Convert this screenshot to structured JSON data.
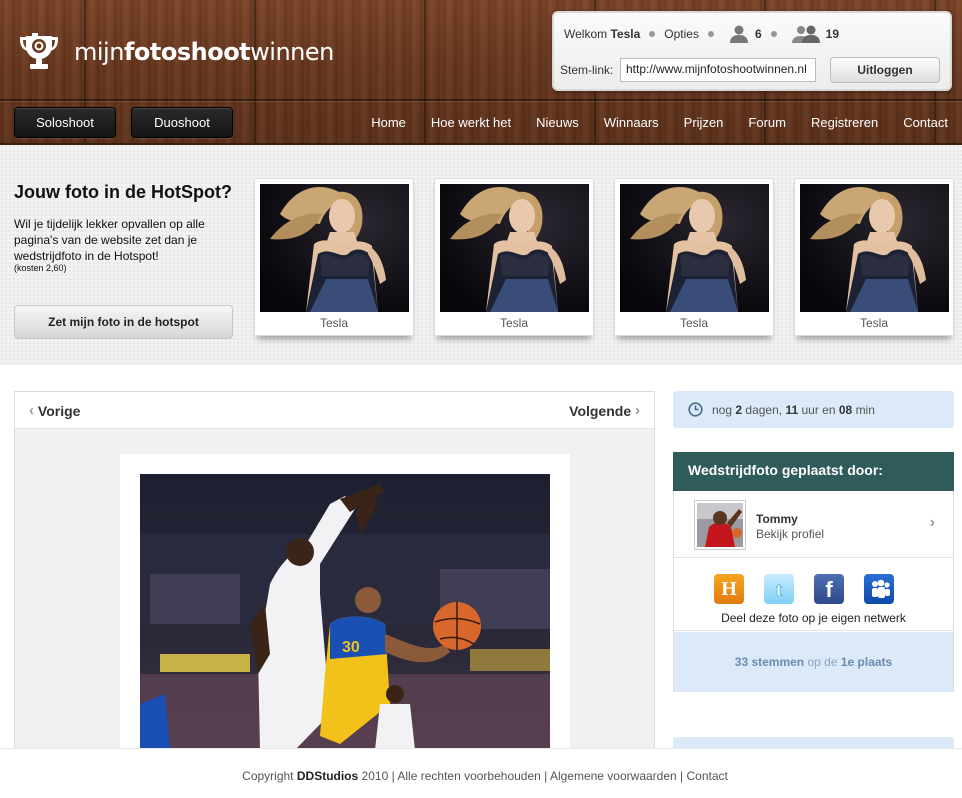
{
  "brand": {
    "logo_text_light_1": "mijn",
    "logo_text_bold": "fotoshoot",
    "logo_text_light_2": "winnen",
    "logo_icon": "trophy-camera-icon"
  },
  "userbox": {
    "welcome_label": "Welkom",
    "username": "Tesla",
    "options_label": "Opties",
    "friends_count": "6",
    "group_count": "19",
    "stem_link_label": "Stem-link:",
    "stem_link_value": "http://www.mijnfotoshootwinnen.nl",
    "logout_label": "Uitloggen"
  },
  "shoot_buttons": {
    "solo": "Soloshoot",
    "duo": "Duoshoot"
  },
  "nav": [
    "Home",
    "Hoe werkt het",
    "Nieuws",
    "Winnaars",
    "Prijzen",
    "Forum",
    "Registreren",
    "Contact"
  ],
  "hotspot": {
    "title": "Jouw foto in de HotSpot?",
    "description": "Wil je tijdelijk lekker opvallen op alle pagina's van de website zet dan je wedstrijdfoto in de Hotspot!",
    "cost": "(kosten 2,60)",
    "button": "Zet mijn foto in de hotspot",
    "cards": [
      {
        "name": "Tesla"
      },
      {
        "name": "Tesla"
      },
      {
        "name": "Tesla"
      },
      {
        "name": "Tesla"
      }
    ]
  },
  "photo_nav": {
    "prev": "Vorige",
    "next": "Volgende"
  },
  "timer": {
    "prefix": "nog",
    "days": "2",
    "days_label": "dagen,",
    "hours": "11",
    "hours_label": "uur en",
    "minutes": "08",
    "minutes_label": "min"
  },
  "owner": {
    "title": "Wedstrijdfoto geplaatst door:",
    "name": "Tommy",
    "profile_link": "Bekijk profiel",
    "share_text": "Deel deze foto op je eigen netwerk",
    "social_icons": [
      "hyves-icon",
      "twitter-icon",
      "facebook-icon",
      "myspace-icon"
    ],
    "votes_count": "33 stemmen",
    "votes_middle": "op de",
    "place": "1e plaats"
  },
  "footer": {
    "copyright": "Copyright",
    "company": "DDStudios",
    "year_text": "2010 |",
    "rights": "Alle rechten voorbehouden",
    "terms": "Algemene voorwaarden",
    "contact": "Contact"
  },
  "colors": {
    "header_wood": "#6b3a22",
    "owner_header": "#2f5b5a",
    "light_blue": "#dbe9f8"
  }
}
